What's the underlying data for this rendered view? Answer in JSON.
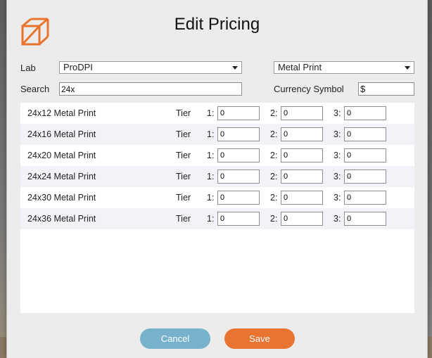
{
  "dialog": {
    "title": "Edit Pricing"
  },
  "form": {
    "lab_label": "Lab",
    "lab_value": "ProDPI",
    "product_value": "Metal Print",
    "search_label": "Search",
    "search_value": "24x",
    "currency_label": "Currency Symbol",
    "currency_value": "$"
  },
  "rows": [
    {
      "name": "24x12 Metal Print",
      "tier_label": "Tier",
      "t1_label": "1:",
      "t1": "0",
      "t2_label": "2:",
      "t2": "0",
      "t3_label": "3:",
      "t3": "0"
    },
    {
      "name": "24x16 Metal Print",
      "tier_label": "Tier",
      "t1_label": "1:",
      "t1": "0",
      "t2_label": "2:",
      "t2": "0",
      "t3_label": "3:",
      "t3": "0"
    },
    {
      "name": "24x20 Metal Print",
      "tier_label": "Tier",
      "t1_label": "1:",
      "t1": "0",
      "t2_label": "2:",
      "t2": "0",
      "t3_label": "3:",
      "t3": "0"
    },
    {
      "name": "24x24 Metal Print",
      "tier_label": "Tier",
      "t1_label": "1:",
      "t1": "0",
      "t2_label": "2:",
      "t2": "0",
      "t3_label": "3:",
      "t3": "0"
    },
    {
      "name": "24x30 Metal Print",
      "tier_label": "Tier",
      "t1_label": "1:",
      "t1": "0",
      "t2_label": "2:",
      "t2": "0",
      "t3_label": "3:",
      "t3": "0"
    },
    {
      "name": "24x36 Metal Print",
      "tier_label": "Tier",
      "t1_label": "1:",
      "t1": "0",
      "t2_label": "2:",
      "t2": "0",
      "t3_label": "3:",
      "t3": "0"
    }
  ],
  "buttons": {
    "cancel": "Cancel",
    "save": "Save"
  },
  "colors": {
    "logo": "#e8742e",
    "cancel": "#76b2cc",
    "save": "#e97431",
    "row_alt": "#f2f3f8"
  },
  "icons": {
    "logo": "cube-wireframe-icon",
    "dropdown": "triangle-down-icon"
  }
}
